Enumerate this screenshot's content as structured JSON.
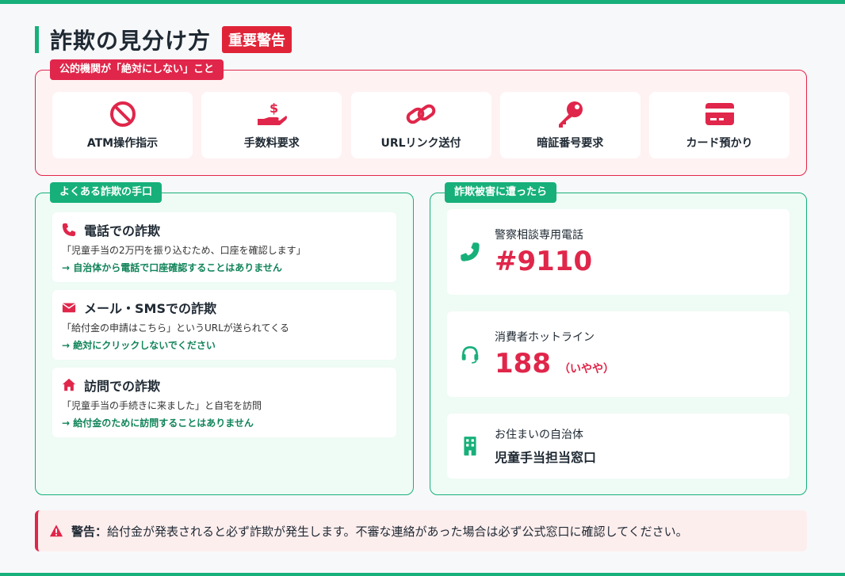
{
  "header": {
    "title": "詐欺の見分け方",
    "badge": "重要警告"
  },
  "never_panel": {
    "label": "公的機関が「絶対にしない」こと",
    "items": [
      {
        "icon": "prohibited-icon",
        "label": "ATM操作指示"
      },
      {
        "icon": "hand-money-icon",
        "label": "手数料要求"
      },
      {
        "icon": "link-icon",
        "label": "URLリンク送付"
      },
      {
        "icon": "key-icon",
        "label": "暗証番号要求"
      },
      {
        "icon": "credit-card-icon",
        "label": "カード預かり"
      }
    ]
  },
  "tactics_panel": {
    "label": "よくある詐欺の手口",
    "items": [
      {
        "icon": "phone-icon",
        "title": "電話での詐欺",
        "desc": "「児童手当の2万円を振り込むため、口座を確認します」",
        "note": "→ 自治体から電話で口座確認することはありません"
      },
      {
        "icon": "envelope-icon",
        "title": "メール・SMSでの詐欺",
        "desc": "「給付金の申請はこちら」というURLが送られてくる",
        "note": "→ 絶対にクリックしないでください"
      },
      {
        "icon": "house-icon",
        "title": "訪問での詐欺",
        "desc": "「児童手当の手続きに来ました」と自宅を訪問",
        "note": "→ 給付金のために訪問することはありません"
      }
    ]
  },
  "help_panel": {
    "label": "詐欺被害に遭ったら",
    "police": {
      "icon": "phone-icon",
      "label": "警察相談専用電話",
      "number": "#9110"
    },
    "consumer": {
      "icon": "headset-icon",
      "label": "消費者ホットライン",
      "number": "188",
      "sub": "（いやや）"
    },
    "office": {
      "icon": "building-icon",
      "label": "お住まいの自治体",
      "name": "児童手当担当窓口"
    }
  },
  "warning": {
    "icon": "warning-icon",
    "strong": "警告：",
    "text": "給付金が発表されると必ず詐欺が発生します。不審な連絡があった場合は必ず公式窓口に確認してください。"
  },
  "colors": {
    "accent_green": "#17b07a",
    "accent_red": "#e0264a"
  }
}
